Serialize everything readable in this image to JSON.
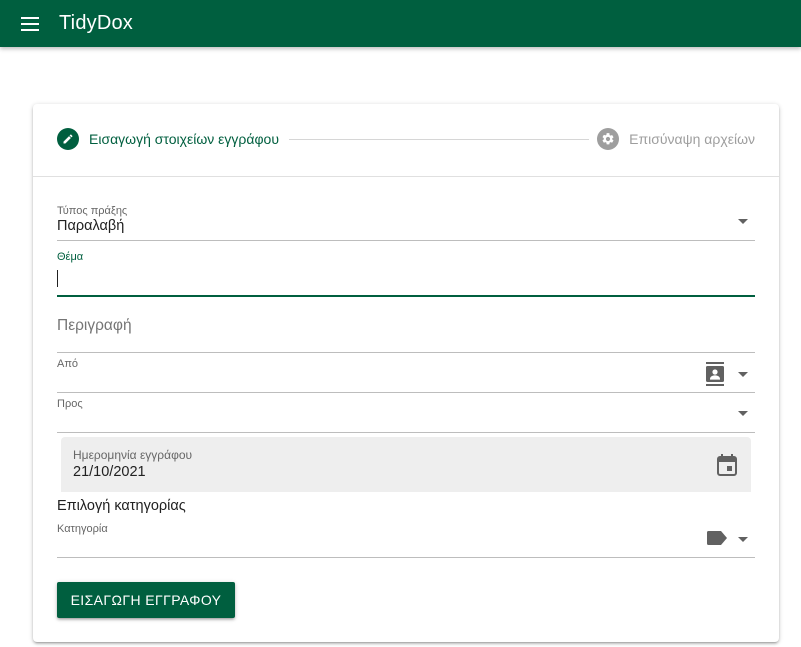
{
  "app": {
    "title": "TidyDox",
    "menu_icon": "hamburger-menu-icon",
    "primary_color": "#005f3f"
  },
  "stepper": {
    "steps": [
      {
        "label": "Εισαγωγή στοιχείων εγγράφου",
        "icon": "pencil-icon",
        "state": "active"
      },
      {
        "label": "Επισύναψη αρχείων",
        "icon": "gear-icon",
        "state": "inactive"
      }
    ]
  },
  "form": {
    "transaction_type": {
      "label": "Τύπος πράξης",
      "value": "Παραλαβή"
    },
    "subject": {
      "label": "Θέμα",
      "value": ""
    },
    "description": {
      "placeholder": "Περιγραφή"
    },
    "from": {
      "label": "Από",
      "value": "",
      "icon": "contact-card-icon"
    },
    "to": {
      "label": "Προς",
      "value": ""
    },
    "document_date": {
      "label": "Ημερομηνία εγγράφου",
      "value": "21/10/2021",
      "icon": "calendar-icon"
    },
    "category_heading": "Επιλογή κατηγορίας",
    "category": {
      "label": "Κατηγορία",
      "value": "",
      "icon": "label-tag-icon"
    },
    "submit_label": "ΕΙΣΑΓΩΓΗ ΕΓΓΡΑΦΟΥ"
  }
}
